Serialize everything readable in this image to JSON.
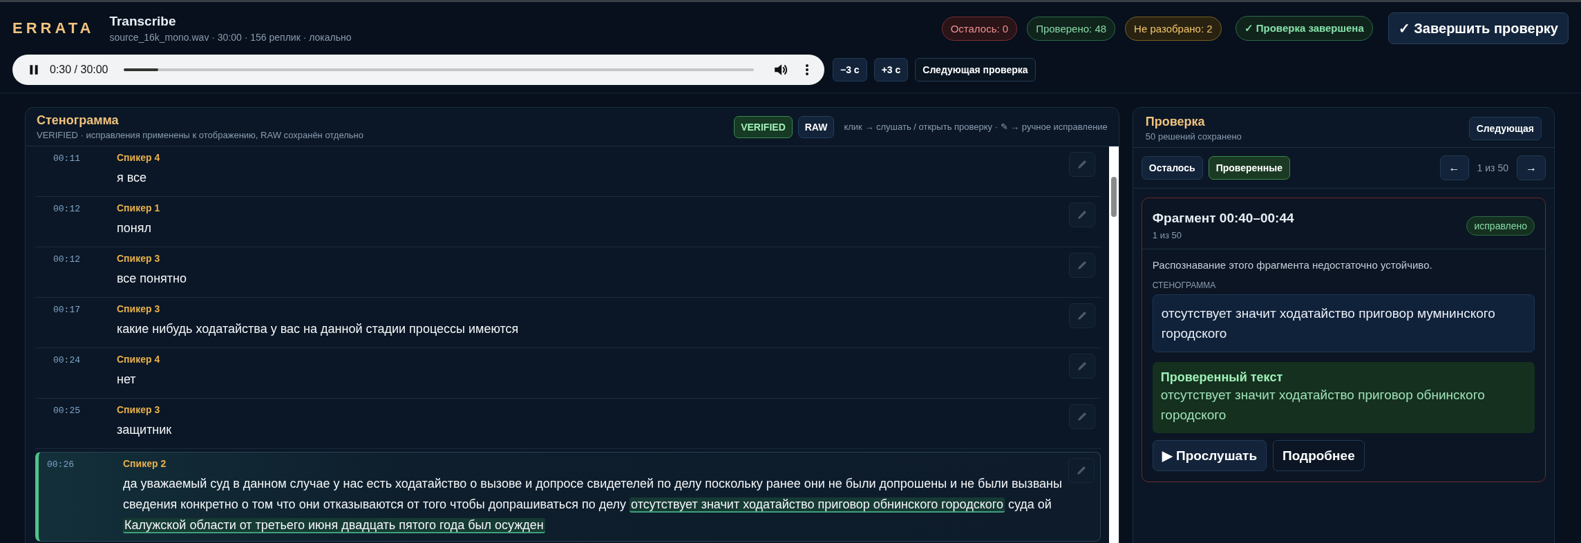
{
  "header": {
    "logo": "ERRATA",
    "title": "Transcribe",
    "subtitle": "source_16k_mono.wav · 30:00 · 156 реплик · локально",
    "stats": [
      {
        "label": "Осталось: 0",
        "kind": "danger"
      },
      {
        "label": "Проверено: 48",
        "kind": "success"
      },
      {
        "label": "Не разобрано: 2",
        "kind": "warning"
      }
    ],
    "status": "✓ Проверка завершена",
    "finish_button": "✓ Завершить проверку"
  },
  "player": {
    "time": "0:30 / 30:00",
    "level": 0.055,
    "playing": true,
    "buttons": [
      "−3 с",
      "+3 с",
      "Следующая проверка"
    ]
  },
  "transcript": {
    "title": "Стенограмма",
    "subtitle": "VERIFIED · исправления применены к отображению, RAW сохранён отдельно",
    "modes": [
      {
        "label": "VERIFIED",
        "selected": true
      },
      {
        "label": "RAW",
        "selected": false
      }
    ],
    "hint": "клик → слушать / открыть проверку · ✎ → ручное исправление",
    "rows": [
      {
        "time": "00:11",
        "speaker": "Спикер 4",
        "selected": false,
        "segments": [
          {
            "text": "я все",
            "highlight": false
          }
        ]
      },
      {
        "time": "00:12",
        "speaker": "Спикер 1",
        "selected": false,
        "segments": [
          {
            "text": "понял",
            "highlight": false
          }
        ]
      },
      {
        "time": "00:12",
        "speaker": "Спикер 3",
        "selected": false,
        "segments": [
          {
            "text": "все понятно",
            "highlight": false
          }
        ]
      },
      {
        "time": "00:17",
        "speaker": "Спикер 3",
        "selected": false,
        "segments": [
          {
            "text": "какие нибудь ходатайства у вас на данной стадии процессы имеются",
            "highlight": false
          }
        ]
      },
      {
        "time": "00:24",
        "speaker": "Спикер 4",
        "selected": false,
        "segments": [
          {
            "text": "нет",
            "highlight": false
          }
        ]
      },
      {
        "time": "00:25",
        "speaker": "Спикер 3",
        "selected": false,
        "segments": [
          {
            "text": "защитник",
            "highlight": false
          }
        ]
      },
      {
        "time": "00:26",
        "speaker": "Спикер 2",
        "selected": true,
        "segments": [
          {
            "text": "да уважаемый суд в данном случае у нас есть ходатайство о вызове и допросе свидетелей по делу поскольку ранее они не были допрошены и не были вызваны сведения конкретно о том что они отказываются от того чтобы допрашиваться по делу ",
            "highlight": false
          },
          {
            "text": "отсутствует значит ходатайство приговор обнинского городского",
            "highlight": true
          },
          {
            "text": " суда ой ",
            "highlight": false
          },
          {
            "text": "Калужской области от третьего июня двадцать пятого года был осужден",
            "highlight": true
          }
        ]
      }
    ]
  },
  "review": {
    "title": "Проверка",
    "subtitle": "50 решений сохранено",
    "next_button": "Следующая",
    "filters": [
      {
        "label": "Осталось",
        "selected": false
      },
      {
        "label": "Проверенные",
        "selected": true
      }
    ],
    "pager": {
      "prev": "←",
      "position": "1 из 50",
      "next": "→"
    },
    "card": {
      "title": "Фрагмент 00:40–00:44",
      "subtitle": "1 из 50",
      "status": "исправлено",
      "note": "Распознавание этого фрагмента недостаточно устойчиво.",
      "section_label": "СТЕНОГРАММА",
      "transcript": "отсутствует значит ходатайство приговор мумнинского городского",
      "verified_title": "Проверенный текст",
      "verified_text": "отсутствует значит ходатайство приговор обнинского городского",
      "buttons": [
        "▶ Прослушать",
        "Подробнее"
      ]
    }
  }
}
